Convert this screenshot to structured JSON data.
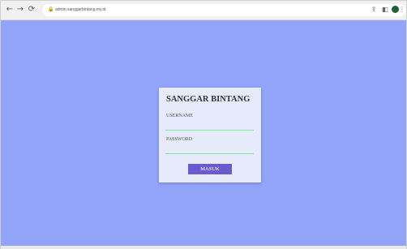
{
  "browser": {
    "url": "admin.sanggarbintang.my.id",
    "icons": {
      "back": "arrow-left-icon",
      "forward": "arrow-right-icon",
      "reload": "reload-icon",
      "lock": "lock-icon",
      "share": "share-icon",
      "bookmark": "star-icon",
      "sidebar": "side-panel-icon",
      "profile": "profile-avatar",
      "menu": "kebab-menu-icon"
    }
  },
  "page": {
    "background_color": "#93a5fb",
    "card_color": "#e7eafb",
    "accent_input": "#7fe8a0",
    "button_color": "#6a5acd"
  },
  "login": {
    "title": "SANGGAR BINTANG",
    "username_label": "USERNAME",
    "username_value": "",
    "password_label": "PASSWORD",
    "password_value": "",
    "submit_label": "MASUK"
  }
}
